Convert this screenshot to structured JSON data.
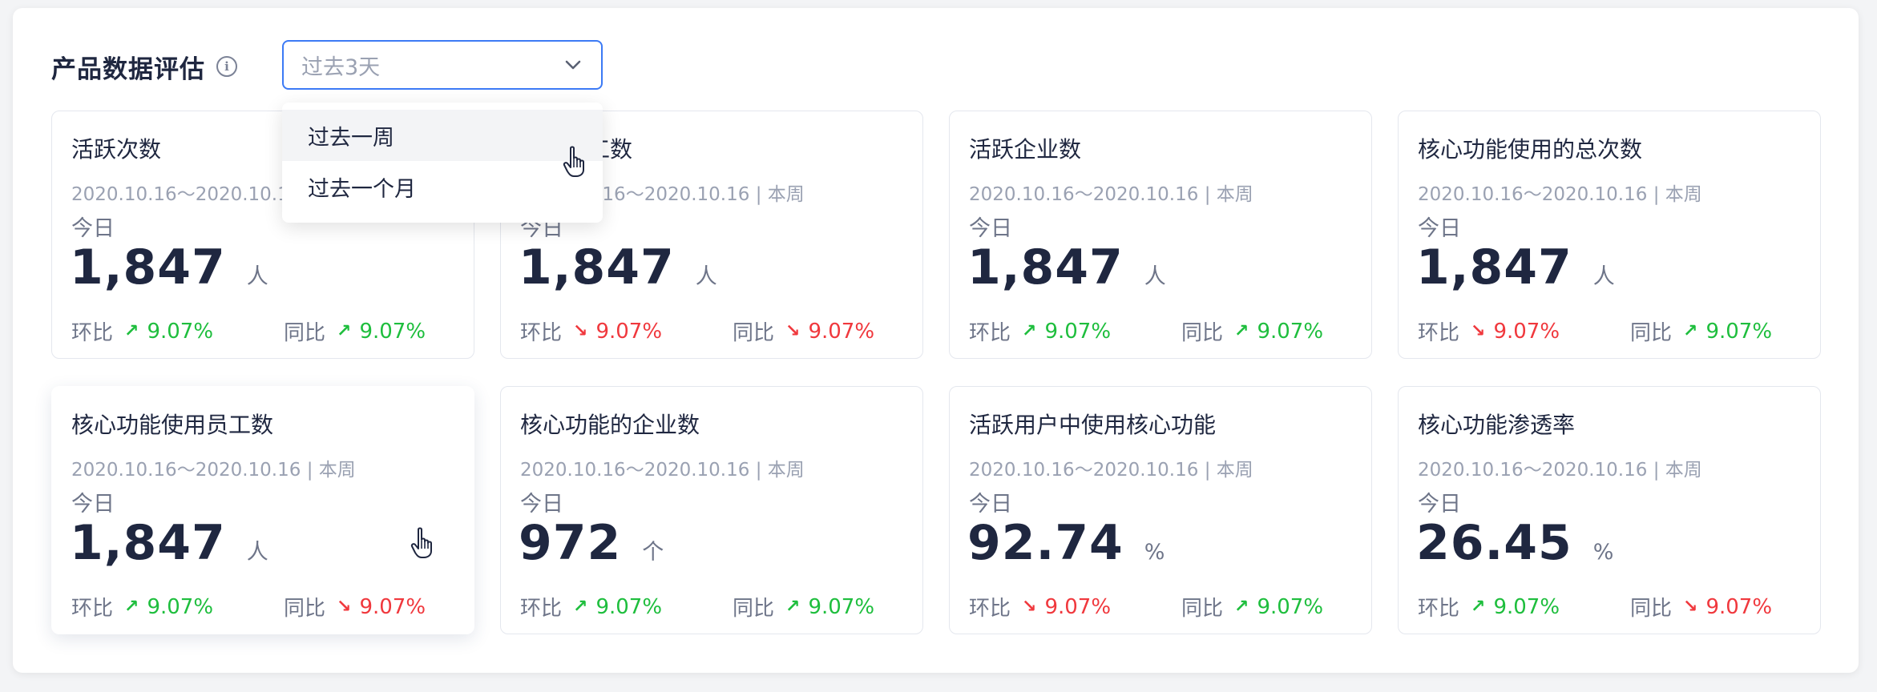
{
  "header": {
    "title": "产品数据评估",
    "info_icon": "info-icon"
  },
  "filter": {
    "selected": "过去3天",
    "options": [
      "过去一周",
      "过去一个月"
    ],
    "hovered_index": 0
  },
  "labels": {
    "period": "今日",
    "mom": "环比",
    "yoy": "同比"
  },
  "colors": {
    "accent": "#3c7af5",
    "up": "#1ebe3d",
    "down": "#f0383d",
    "text": "#1f2740"
  },
  "cards": [
    {
      "title": "活跃次数",
      "date": "2020.10.16～2020.10.16 | 本周",
      "value": "1,847",
      "unit": "人",
      "mom": {
        "dir": "up",
        "value": "9.07%"
      },
      "yoy": {
        "dir": "up",
        "value": "9.07%"
      }
    },
    {
      "title": "活跃员工数",
      "date": "2020.10.16～2020.10.16 | 本周",
      "value": "1,847",
      "unit": "人",
      "mom": {
        "dir": "down",
        "value": "9.07%"
      },
      "yoy": {
        "dir": "down",
        "value": "9.07%"
      }
    },
    {
      "title": "活跃企业数",
      "date": "2020.10.16～2020.10.16 | 本周",
      "value": "1,847",
      "unit": "人",
      "mom": {
        "dir": "up",
        "value": "9.07%"
      },
      "yoy": {
        "dir": "up",
        "value": "9.07%"
      }
    },
    {
      "title": "核心功能使用的总次数",
      "date": "2020.10.16～2020.10.16 | 本周",
      "value": "1,847",
      "unit": "人",
      "mom": {
        "dir": "down",
        "value": "9.07%"
      },
      "yoy": {
        "dir": "up",
        "value": "9.07%"
      }
    },
    {
      "title": "核心功能使用员工数",
      "date": "2020.10.16～2020.10.16 | 本周",
      "value": "1,847",
      "unit": "人",
      "mom": {
        "dir": "up",
        "value": "9.07%"
      },
      "yoy": {
        "dir": "down",
        "value": "9.07%"
      }
    },
    {
      "title": "核心功能的企业数",
      "date": "2020.10.16～2020.10.16 | 本周",
      "value": "972",
      "unit": "个",
      "mom": {
        "dir": "up",
        "value": "9.07%"
      },
      "yoy": {
        "dir": "up",
        "value": "9.07%"
      }
    },
    {
      "title": "活跃用户中使用核心功能",
      "date": "2020.10.16～2020.10.16 | 本周",
      "value": "92.74",
      "unit": "%",
      "mom": {
        "dir": "down",
        "value": "9.07%"
      },
      "yoy": {
        "dir": "up",
        "value": "9.07%"
      }
    },
    {
      "title": "核心功能渗透率",
      "date": "2020.10.16～2020.10.16 | 本周",
      "value": "26.45",
      "unit": "%",
      "mom": {
        "dir": "up",
        "value": "9.07%"
      },
      "yoy": {
        "dir": "down",
        "value": "9.07%"
      }
    }
  ]
}
